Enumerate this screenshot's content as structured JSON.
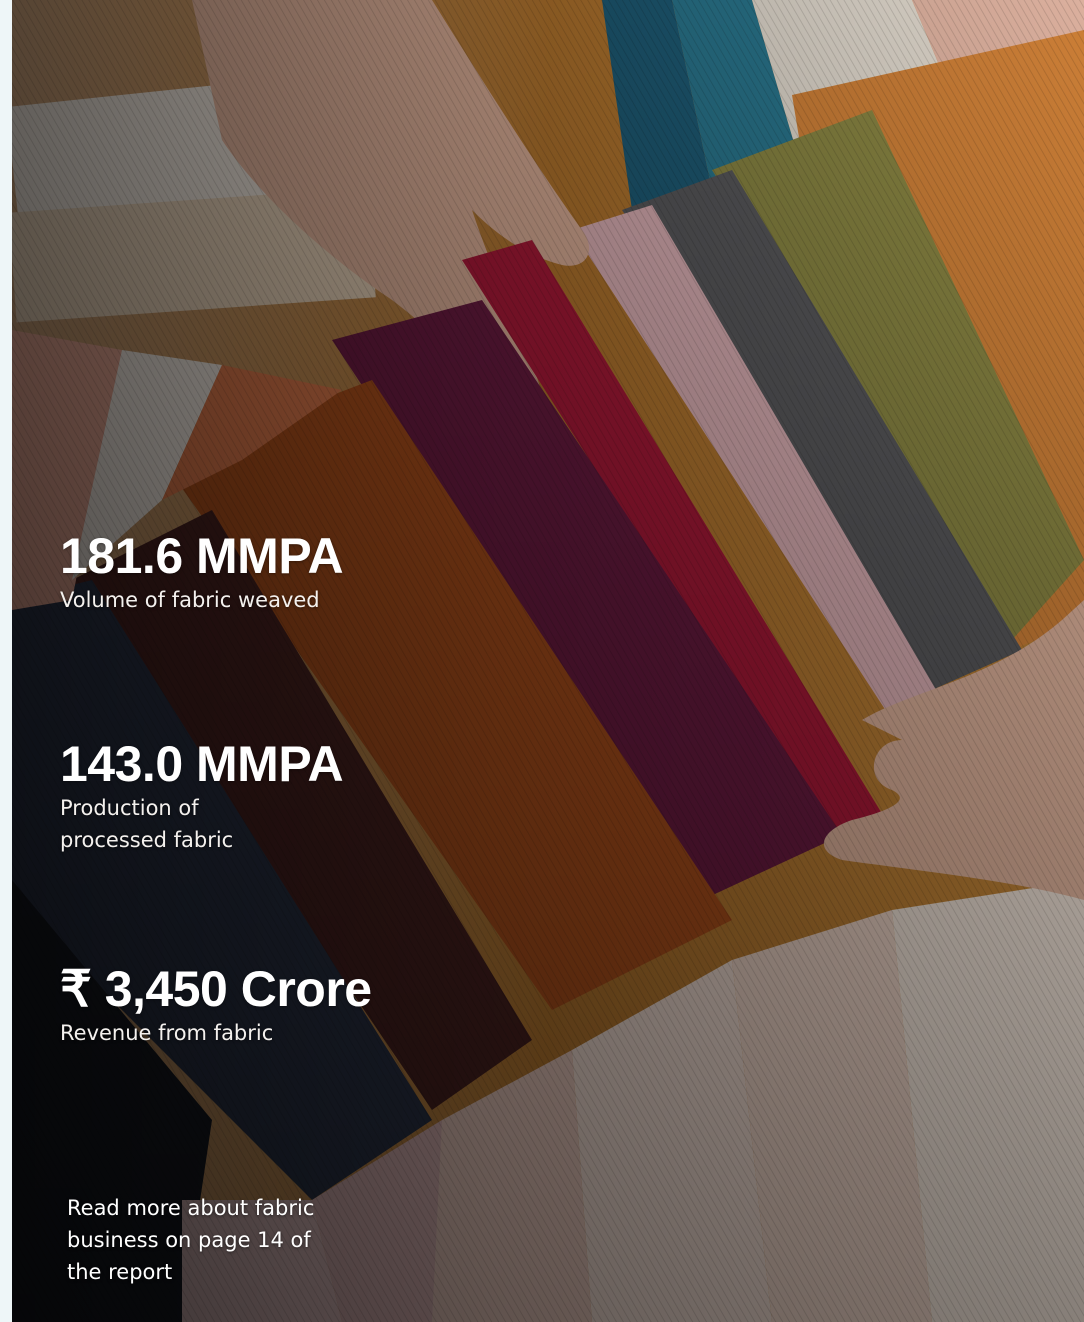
{
  "stats": [
    {
      "value": "181.6 MMPA",
      "label": "Volume of fabric weaved"
    },
    {
      "value": "143.0 MMPA",
      "label": "Production of processed fabric"
    },
    {
      "value": "₹ 3,450 Crore",
      "label": "Revenue from fabric"
    }
  ],
  "read_more": "Read more about fabric business on page 14 of the report",
  "colors": {
    "page_background": "#eef6f8",
    "text": "#ffffff"
  }
}
